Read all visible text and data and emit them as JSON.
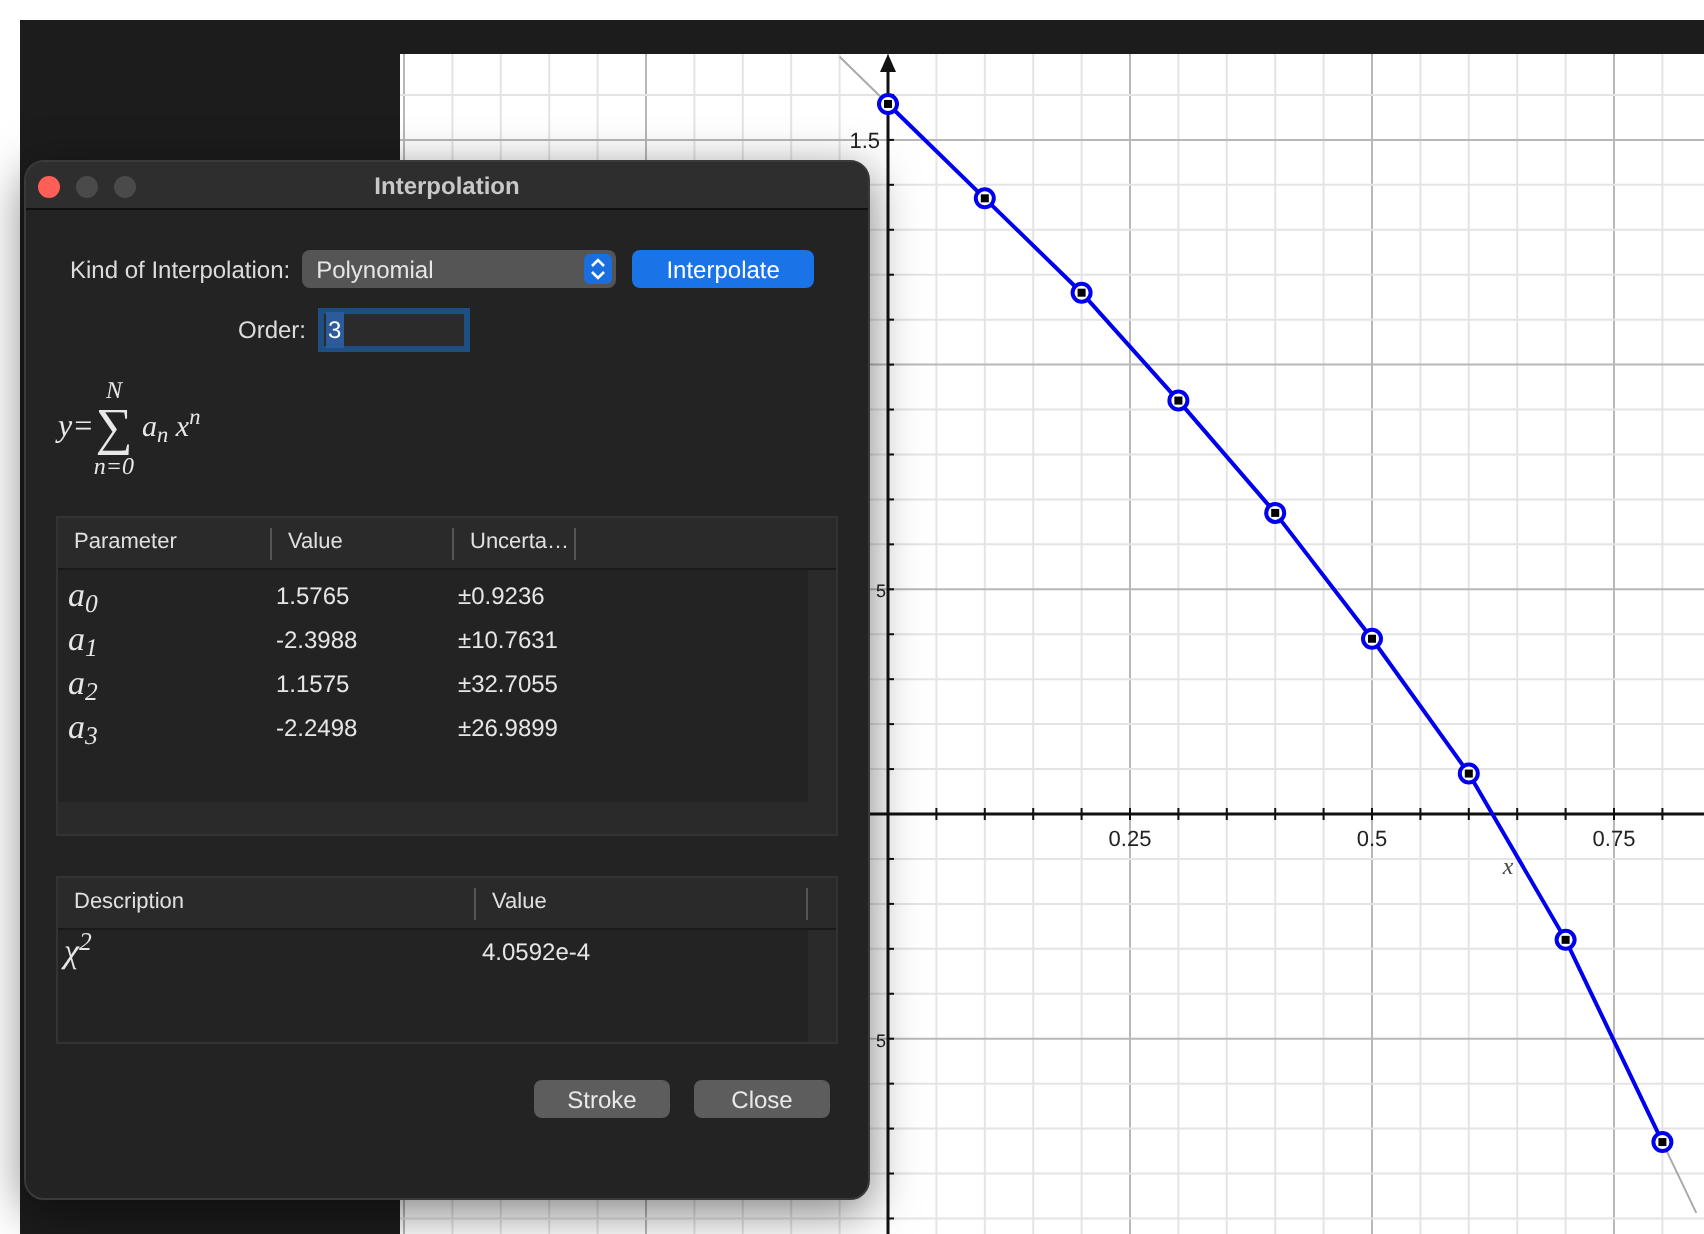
{
  "dialog": {
    "title": "Interpolation",
    "kind_label": "Kind of Interpolation:",
    "kind_value": "Polynomial",
    "interpolate_button": "Interpolate",
    "order_label": "Order:",
    "order_value": "3",
    "formula": {
      "lhs": "y=",
      "sum_symbol": "∑",
      "sum_upper": "N",
      "sum_lower": "n=0",
      "term": "a$_{n}$ x$^{n}$"
    },
    "parameters": {
      "columns": [
        "Parameter",
        "Value",
        "Uncerta…"
      ],
      "rows": [
        {
          "parameter": "a$_{0}$",
          "value": "1.5765",
          "uncertainty": "±0.9236"
        },
        {
          "parameter": "a$_{1}$",
          "value": "-2.3988",
          "uncertainty": "±10.7631"
        },
        {
          "parameter": "a$_{2}$",
          "value": "1.1575",
          "uncertainty": "±32.7055"
        },
        {
          "parameter": "a$_{3}$",
          "value": "-2.2498",
          "uncertainty": "±26.9899"
        }
      ]
    },
    "results": {
      "columns": [
        "Description",
        "Value"
      ],
      "rows": [
        {
          "description": "χ$^{2}$",
          "value": "4.0592e-4"
        }
      ]
    },
    "buttons": [
      "Stroke",
      "Close"
    ]
  },
  "plot": {
    "x_tick_labels": [
      "0.25",
      "0.5",
      "0.75"
    ],
    "y_tick_labels": [
      "1.5",
      "5",
      "5"
    ],
    "axis_label": "x"
  }
}
